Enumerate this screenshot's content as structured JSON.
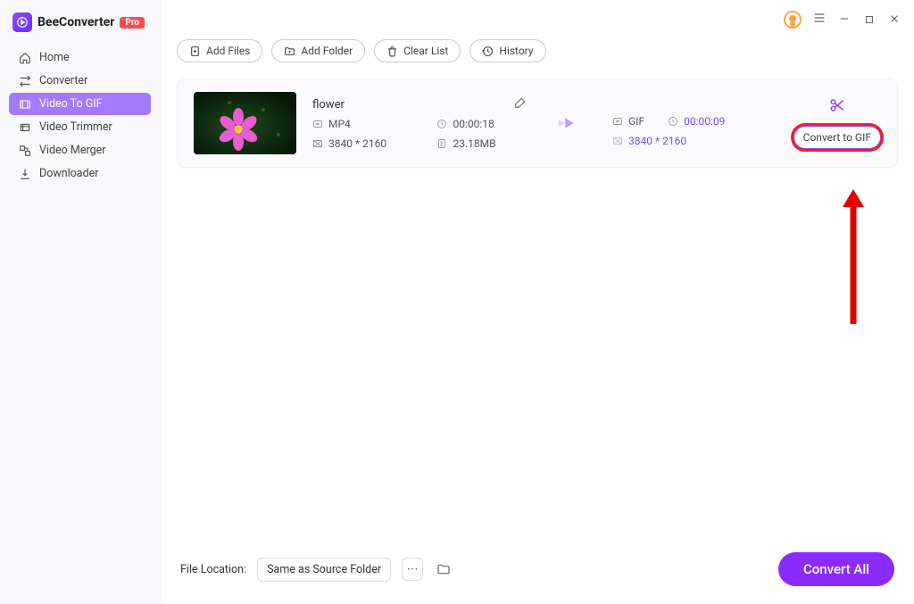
{
  "app": {
    "name": "BeeConverter",
    "badge": "Pro"
  },
  "sidebar": {
    "items": [
      {
        "label": "Home",
        "icon": "home"
      },
      {
        "label": "Converter",
        "icon": "converter"
      },
      {
        "label": "Video To GIF",
        "icon": "gif",
        "active": true
      },
      {
        "label": "Video Trimmer",
        "icon": "trimmer"
      },
      {
        "label": "Video Merger",
        "icon": "merger"
      },
      {
        "label": "Downloader",
        "icon": "download"
      }
    ]
  },
  "toolbar": {
    "add_files": "Add Files",
    "add_folder": "Add Folder",
    "clear_list": "Clear List",
    "history": "History"
  },
  "item": {
    "name": "flower",
    "src_format": "MP4",
    "src_duration": "00:00:18",
    "src_resolution": "3840 * 2160",
    "src_size": "23.18MB",
    "dst_format": "GIF",
    "dst_duration": "00:00:09",
    "dst_resolution": "3840 * 2160",
    "convert_label": "Convert to GIF"
  },
  "footer": {
    "location_label": "File Location:",
    "location_value": "Same as Source Folder",
    "convert_all": "Convert All"
  }
}
